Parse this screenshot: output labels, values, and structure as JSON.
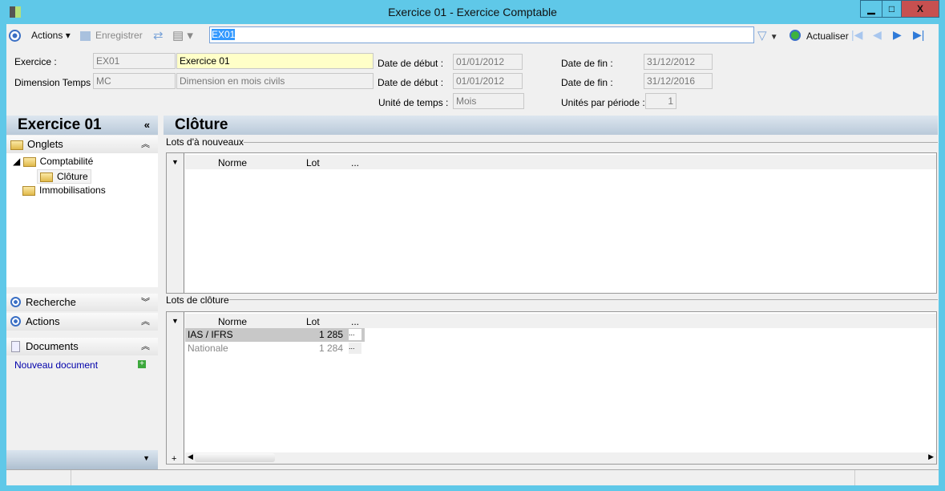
{
  "window": {
    "title": "Exercice 01 -  Exercice Comptable",
    "minimize": "▁",
    "maximize": "□",
    "close": "X"
  },
  "toolbar": {
    "actions": "Actions",
    "save": "Enregistrer",
    "search_value": "EX01",
    "refresh": "Actualiser"
  },
  "form": {
    "exercice_label": "Exercice :",
    "exercice_code": "EX01",
    "exercice_name": "Exercice 01",
    "dimension_label": "Dimension Temps :",
    "dimension_code": "MC",
    "dimension_name": "Dimension en mois civils",
    "start1_label": "Date de début :",
    "start1": "01/01/2012",
    "start2_label": "Date de début :",
    "start2": "01/01/2012",
    "unit_label": "Unité de temps :",
    "unit": "Mois",
    "end1_label": "Date de fin :",
    "end1": "31/12/2012",
    "end2_label": "Date de fin :",
    "end2": "31/12/2016",
    "units_per_label": "Unités par période :",
    "units_per": "1"
  },
  "sidebar": {
    "title": "Exercice 01",
    "collapse": "«",
    "tabs_label": "Onglets",
    "tree": [
      {
        "label": "Comptabilité"
      },
      {
        "label": "Clôture"
      },
      {
        "label": "Immobilisations"
      }
    ],
    "search": "Recherche",
    "actions": "Actions",
    "documents": "Documents",
    "new_doc": "Nouveau document"
  },
  "main": {
    "title": "Clôture",
    "group1": {
      "label": "Lots d'à nouveaux",
      "columns": [
        "Norme",
        "Lot",
        "..."
      ]
    },
    "group2": {
      "label": "Lots de clôture",
      "columns": [
        "Norme",
        "Lot",
        "..."
      ],
      "rows": [
        {
          "norme": "IAS / IFRS",
          "lot": "1 285",
          "btn": "..."
        },
        {
          "norme": "Nationale",
          "lot": "1 284",
          "btn": "..."
        }
      ]
    }
  }
}
